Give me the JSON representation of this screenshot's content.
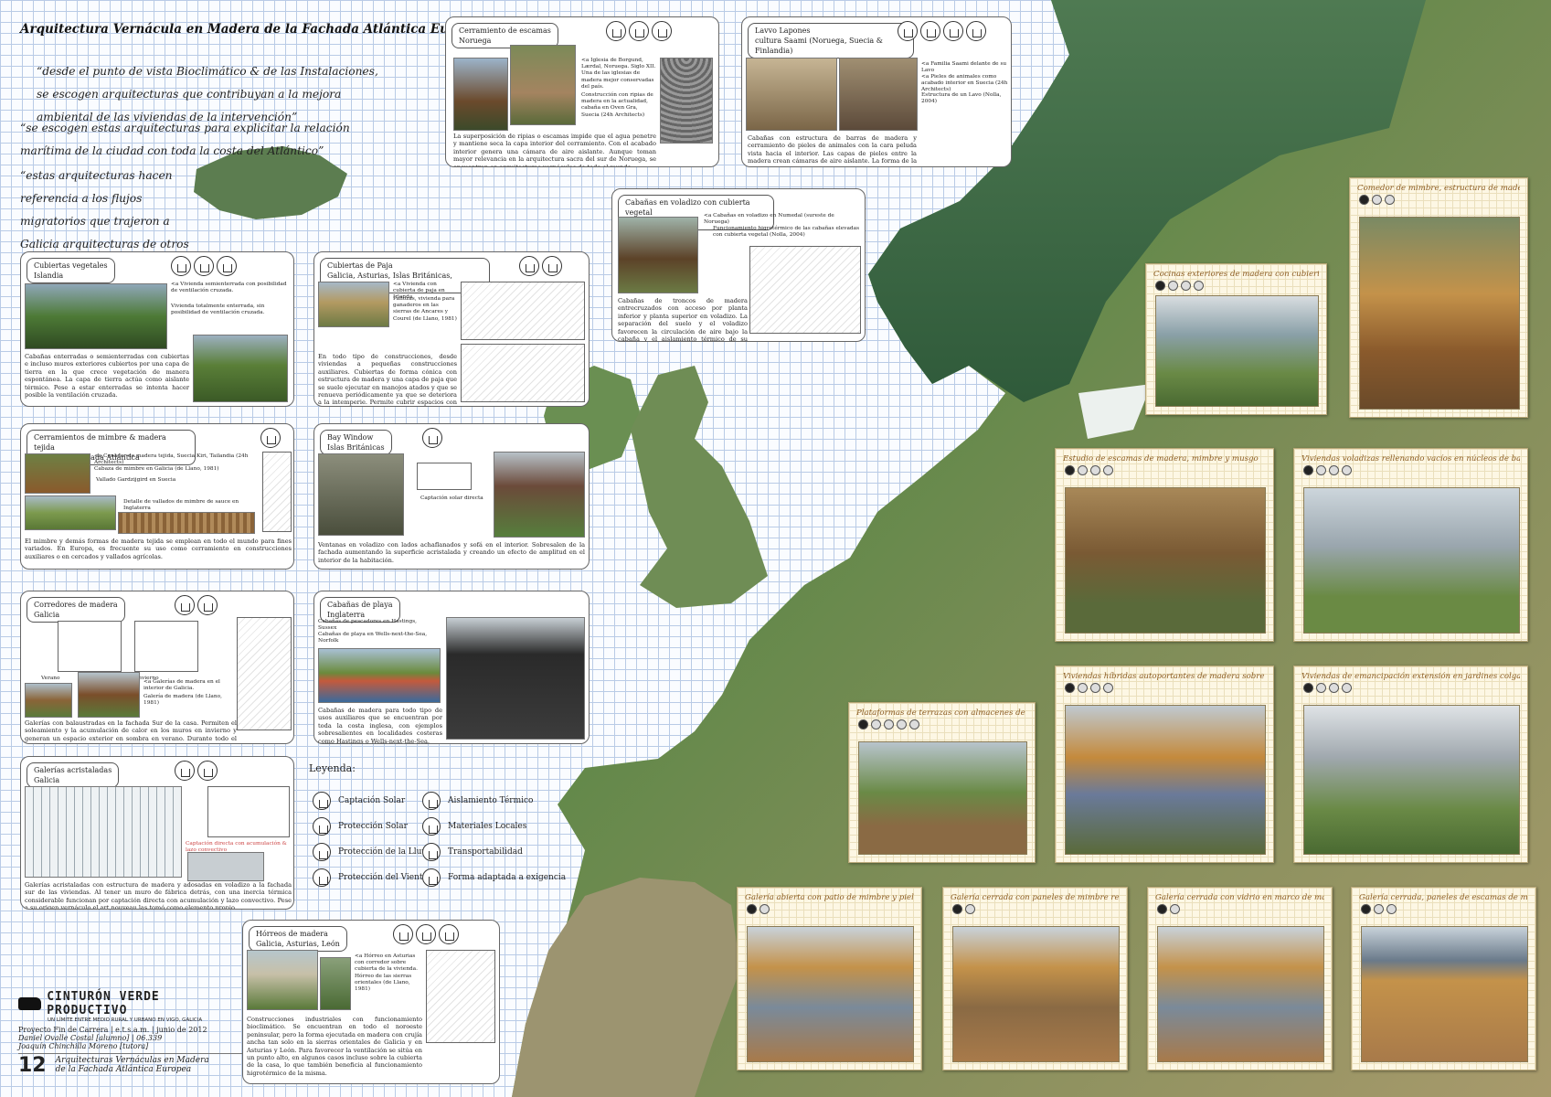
{
  "title": "Arquitectura Vernácula en Madera de la Fachada Atlántica Europea",
  "quotes": [
    "“desde el punto de vista Bioclimático & de las Instalaciones, se escogen arquitecturas que contribuyan a la mejora ambiental de las viviendas de la intervención”",
    "“se escogen estas arquitecturas para explicitar la relación marítima de la ciudad con toda la costa del Atlántico”",
    "“estas arquitecturas hacen referencia a los flujos migratorios que trajeron a Galicia arquitecturas de otros llugares del mundo”"
  ],
  "cards": {
    "escamas": {
      "title": "Cerramiento de escamas\nNoruega",
      "note1": "<a Iglesia de Borgund, Lærdal, Noruega. Siglo XII. Una de las iglesias de madera mejor conservadas del país.",
      "note2": "Construcción con ripias de madera en la actualidad, cabaña en Oven Gra, Suecia (24h Architects)",
      "text": "La superposición de ripias o escamas impide que el agua penetre y mantiene seca la capa interior del cerramiento. Con el acabado interior genera una cámara de aire aislante. Aunque toman mayor relevancia en la arquitectura sacra del sur de Noruega, se encuentran en arquitecturas vernáculas de todo el mundo."
    },
    "lavo": {
      "title": "Lavvo Lapones\ncultura Saami (Noruega, Suecia & Finlandia)",
      "note1": "<a Familia Saami delante de su Lavo",
      "note2": "<a Pieles de animales como acabado interior en Suecia (24h Architects)",
      "note3": "Estructura de un Lavo (Nolla, 2004)",
      "text": "Cabañas con estructura de barras de madera y cerramiento de pieles de animales con la cara peluda vista hacia el interior. Las capas de pieles entre la madera crean cámaras de aire aislante. La forma de la cabaña protege del viento."
    },
    "voladizo": {
      "title": "Cabañas en voladizo con cubierta vegetal\nNoruega",
      "note1": "<a Cabañas en voladizo en Numedal (sureste de Noruega)",
      "note2": "Funcionamiento higrotérmico de las cabañas elevadas con cubierta vegetal (Nolla, 2004)",
      "text": "Cabañas de troncos de madera entrecruzados con acceso por planta inferior y planta superior en voladizo. La separación del suelo y el voladizo favorecen la circulación de aire bajo la cabaña y el aislamiento térmico de su interior. La cubierta vegetal proporciona aislamiento excepcional."
    },
    "vegetales": {
      "title": "Cubiertas vegetales\nIslandia",
      "note1": "<a Vivienda semienterrada con posibilidad de ventilación cruzada.",
      "note2": "Vivienda totalmente enterrada, sin posibilidad de ventilación cruzada.",
      "text": "Cabañas enterradas o semienterradas con cubiertas e incluso muros exteriores cubiertos por una capa de tierra en la que crece vegetación de manera espontánea. La capa de tierra actúa como aislante térmico. Pese a estar enterradas se intenta hacer posible la ventilación cruzada."
    },
    "paja": {
      "title": "Cubiertas de Paja\nGalicia, Asturias, Islas Británicas, Dinamarca",
      "note1": "<a Vivienda con cubierta de paja en Irlanda",
      "note2": "Pallozas, vivienda para ganaderos en las sierras de Ancares y Courel (de Llano, 1981)",
      "text": "En todo tipo de construcciones, desde viviendas a pequeñas construcciones auxiliares. Cubiertas de forma cónica con estructura de madera y una capa de paja que se suele ejecutar en manojos atados y que se renueva periódicamente ya que se deteriora a la intemperie. Permite cubrir espacios con formas irregulares en planta."
    },
    "mimbre": {
      "title": "Cerramientos de mimbre & madera tejida\nen toda la Fachada Atlántica",
      "note1": "<a Cenador de madera tejida, Suecia Kiri, Tailandia (24h Architects)",
      "note2": "Cabaza de mimbre en Galicia (de Llano, 1981)",
      "note3": "Vallado Gardzijgird en Suecia",
      "note4": "Detalle de vallados de mimbre de sauce en Inglaterra",
      "text": "El mimbre y demás formas de madera tejida se emplean en todo el mundo para fines variados. En Europa, es frecuente su uso como cerramiento en construcciones auxiliares o en cercados y vallados agrícolas."
    },
    "bay": {
      "title": "Bay Window\nIslas Británicas",
      "note1": "Captación solar directa",
      "text": "Ventanas en voladizo con lados achaflanados y sofá en el interior. Sobresalen de la fachada aumentando la superficie acristalada y creando un efecto de amplitud en el interior de la habitación."
    },
    "corredores": {
      "title": "Corredores de madera\nGalicia",
      "note1": "Verano",
      "note2": "Invierno",
      "note3": "<a Galerías de madera en el interior de Galicia.",
      "note4": "Galería de madera (de Llano, 1981)",
      "text": "Galerías con balaustradas en la fachada Sur de la casa. Permiten el soleamiento y la acumulación de calor en los muros en invierno y generan un espacio exterior en sombra en verano. Durante todo el año proporcionan un espacio exterior resguardado de la lluvia."
    },
    "playa": {
      "title": "Cabañas de playa\nInglaterra",
      "note1": "Cabañas de pescadores en Hastings, Sussex",
      "note2": "Cabañas de playa en Wells-next-the-Sea, Norfolk",
      "text": "Cabañas de madera para todo tipo de usos auxiliares que se encuentran por toda la costa inglesa, con ejemplos sobresalientes en localidades costeras como Hastings o Wells-next-the-Sea."
    },
    "galerias": {
      "title": "Galerías acristaladas\nGalicia",
      "note1": "Captación directa con acumulación & lazo convectivo",
      "text": "Galerías acristaladas con estructura de madera y adosadas en voladizo a la fachada sur de las viviendas. Al tener un muro de fábrica detrás, con una inercia térmica considerable funcionan por captación directa con acumulación y lazo convectivo. Pese a su origen vernáculo el art nouveau las tomó como elemento propio."
    },
    "horreos": {
      "title": "Hórreos de madera\nGalicia, Asturias, León",
      "note1": "<a Hórreo en Asturias con corredor sobre cubierta de la vivienda.",
      "note2": "Hórreo de las sierras orientales (de Llano, 1981)",
      "text": "Construcciones industriales con funcionamiento bioclimático. Se encuentran en todo el noroeste peninsular, pero la forma ejecutada en madera con crujía ancha tan solo en la sierras orientales de Galicia y en Asturias y León. Para favorecer la ventilación se sitúa en un punto alto, en algunos casos incluso sobre la cubierta de la casa, lo que también beneficia al funcionamiento higrotérmico de la misma."
    }
  },
  "panels": [
    "Cocinas exteriores de madera con cubierta vegetal",
    "Comedor de mimbre, estructura de madera laminada",
    "Estudio de escamas de madera, mimbre y musgo",
    "Viviendas voladizas rellenando vacíos en núcleos de baja densidad conservados",
    "Viviendas híbridas autoportantes de madera sobre viviendas existentes",
    "Viviendas de emancipación extensión en jardines colgantes",
    "Plataformas de terrazas con almacenes de mimbre",
    "Galería abierta con patio de mimbre y piel vegetal",
    "Galería cerrada con paneles de mimbre retráctiles",
    "Galería cerrada con vidrio en marco de madera",
    "Galería cerrada, paneles de escamas de madera, y lazy sunbox"
  ],
  "legend": {
    "title": "Leyenda:",
    "items": [
      "Captación Solar",
      "Aislamiento Térmico",
      "Protección Solar",
      "Materiales Locales",
      "Protección de la Lluvia",
      "Transportabilidad",
      "Protección del Viento",
      "Forma adaptada a exigencia"
    ]
  },
  "footer": {
    "brand": "CINTURÓN VERDE PRODUCTIVO",
    "subtitle": "UN LÍMITE ENTRE MEDIO RURAL Y URBANO EN VIGO, GALICIA",
    "line1": "Proyecto Fin de Carrera | e.t.s.a.m. | junio de 2012",
    "line2": "Daniel Ovalle Costal [alumno] | 06.339",
    "line3": "Joaquín Chinchilla Moreno [tutora]",
    "number": "12",
    "caption": "Arquitecturas Vernáculas en Madera de la Fachada Atlántica Europea"
  },
  "colors": {
    "sea": "#fafcff",
    "grid": "#b9cbe6",
    "land": "#5b7f45",
    "panel": "#fdf7e4",
    "panel_title": "#8a5a20"
  }
}
